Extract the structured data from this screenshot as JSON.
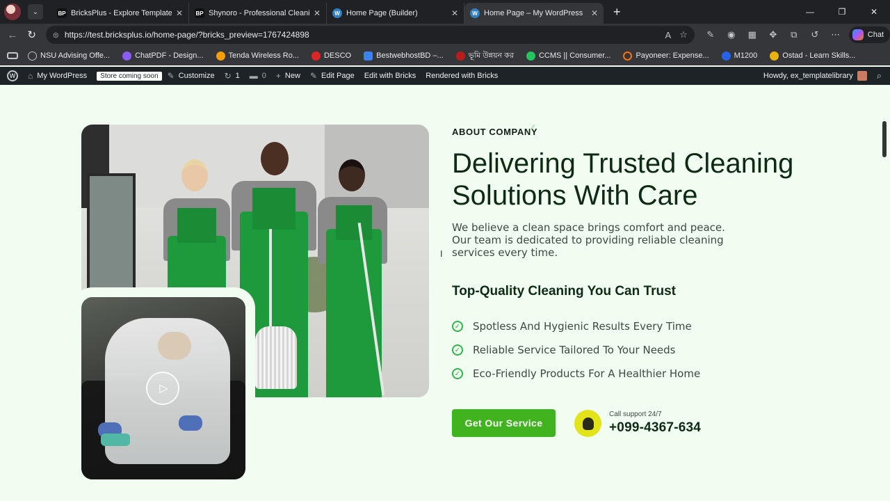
{
  "browser": {
    "tabs": [
      {
        "title": "BricksPlus - Explore Template Pack",
        "favicon": "BP",
        "active": false
      },
      {
        "title": "Shynoro - Professional Cleaning Se",
        "favicon": "BP",
        "active": false
      },
      {
        "title": "Home Page (Builder)",
        "favicon": "wp",
        "active": false
      },
      {
        "title": "Home Page – My WordPress",
        "favicon": "wp",
        "active": true
      }
    ],
    "url": "https://test.bricksplus.io/home-page/?bricks_preview=1767424898",
    "chat_label": "Chat",
    "bookmarks": [
      {
        "label": "NSU Advising Offe...",
        "icon_color": "#9aa0a6"
      },
      {
        "label": "ChatPDF - Design...",
        "icon_color": "#8b5cf6"
      },
      {
        "label": "Tenda Wireless Ro...",
        "icon_color": "#f59e0b"
      },
      {
        "label": "DESCO",
        "icon_color": "#dc2626"
      },
      {
        "label": "BestwebhostBD –...",
        "icon_color": "#3b82f6"
      },
      {
        "label": "ভূমি উন্নয়ন কর",
        "icon_color": "#b91c1c"
      },
      {
        "label": "CCMS || Consumer...",
        "icon_color": "#22c55e"
      },
      {
        "label": "Payoneer: Expense...",
        "icon_color": "#f97316"
      },
      {
        "label": "M1200",
        "icon_color": "#2563eb"
      },
      {
        "label": "Ostad - Learn Skills...",
        "icon_color": "#eab308"
      }
    ]
  },
  "wp_admin_bar": {
    "site_name": "My WordPress",
    "store_badge": "Store coming soon",
    "customize": "Customize",
    "updates_count": "1",
    "comments_count": "0",
    "new": "New",
    "edit_page": "Edit Page",
    "edit_with_bricks": "Edit with Bricks",
    "rendered_with": "Rendered with Bricks",
    "howdy": "Howdy, ex_templatelibrary"
  },
  "section": {
    "eyebrow": "ABOUT COMPANY",
    "headline": "Delivering Trusted Cleaning Solutions With Care",
    "lead": "We believe a clean space brings comfort and peace. Our team is dedicated to providing reliable cleaning services every time.",
    "subhead": "Top-Quality Cleaning You Can Trust",
    "features": [
      "Spotless And Hygienic Results Every Time",
      "Reliable Service Tailored To Your Needs",
      "Eco-Friendly Products For A Healthier Home"
    ],
    "cta_label": "Get Our Service",
    "support_label": "Call support 24/7",
    "support_phone": "+099-4367-634"
  },
  "colors": {
    "page_bg": "#f0fdf0",
    "accent_green": "#40b31f",
    "heading": "#0f2a14",
    "support_icon_bg": "#e3e31a"
  }
}
